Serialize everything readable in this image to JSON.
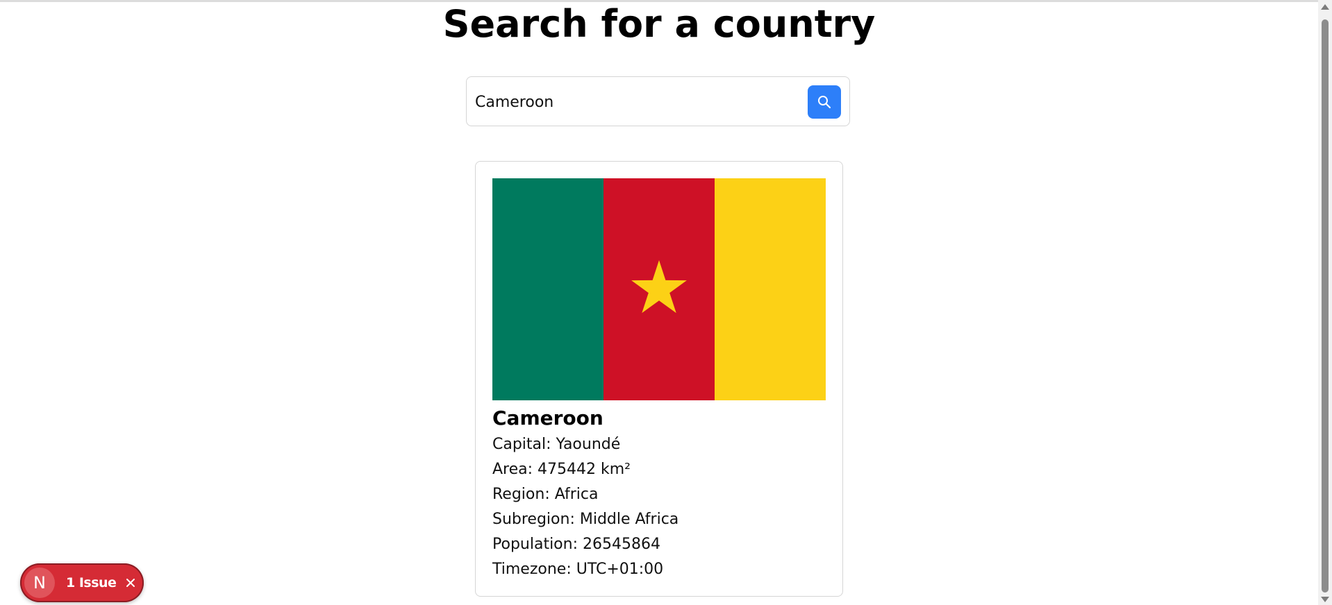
{
  "page": {
    "title": "Search for a country"
  },
  "search": {
    "value": "Cameroon",
    "button_icon": "search-icon",
    "button_color": "#2d7ff9"
  },
  "country": {
    "name": "Cameroon",
    "flag": {
      "description_colors": [
        "#007a5e",
        "#ce1126",
        "#fcd116"
      ],
      "star_color": "#fcd116"
    },
    "details": {
      "capital": "Capital: Yaoundé",
      "area": "Area: 475442 km²",
      "region": "Region: Africa",
      "subregion": "Subregion: Middle Africa",
      "population": "Population: 26545864",
      "timezone": "Timezone: UTC+01:00"
    }
  },
  "issues_badge": {
    "logo_letter": "N",
    "label": "1 Issue",
    "close_icon": "close-icon",
    "color": "#d52b35"
  }
}
